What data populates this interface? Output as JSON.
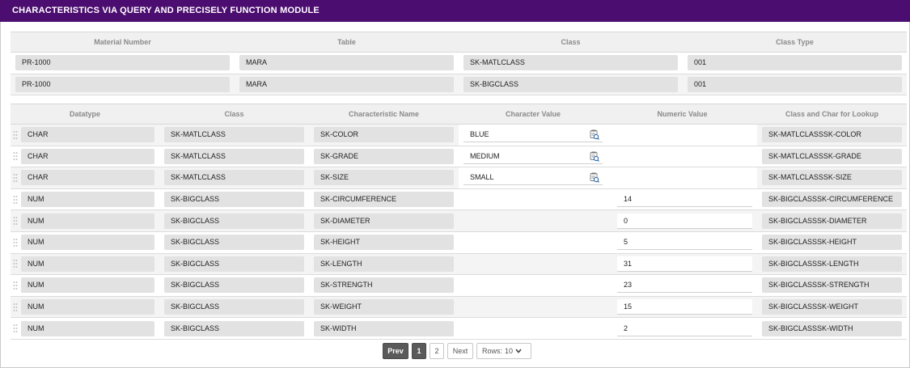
{
  "title": "CHARACTERISTICS VIA QUERY AND PRECISELY FUNCTION MODULE",
  "top_table": {
    "headers": [
      "Material Number",
      "Table",
      "Class",
      "Class Type"
    ],
    "rows": [
      {
        "material": "PR-1000",
        "table": "MARA",
        "class": "SK-MATLCLASS",
        "class_type": "001"
      },
      {
        "material": "PR-1000",
        "table": "MARA",
        "class": "SK-BIGCLASS",
        "class_type": "001"
      }
    ]
  },
  "char_table": {
    "headers": [
      "Datatype",
      "Class",
      "Characteristic Name",
      "Character Value",
      "Numeric Value",
      "Class and Char for Lookup"
    ],
    "rows": [
      {
        "datatype": "CHAR",
        "class": "SK-MATLCLASS",
        "char_name": "SK-COLOR",
        "char_value": "BLUE",
        "num_value": "",
        "lookup": "SK-MATLCLASSSK-COLOR"
      },
      {
        "datatype": "CHAR",
        "class": "SK-MATLCLASS",
        "char_name": "SK-GRADE",
        "char_value": "MEDIUM",
        "num_value": "",
        "lookup": "SK-MATLCLASSSK-GRADE"
      },
      {
        "datatype": "CHAR",
        "class": "SK-MATLCLASS",
        "char_name": "SK-SIZE",
        "char_value": "SMALL",
        "num_value": "",
        "lookup": "SK-MATLCLASSSK-SIZE"
      },
      {
        "datatype": "NUM",
        "class": "SK-BIGCLASS",
        "char_name": "SK-CIRCUMFERENCE",
        "char_value": "",
        "num_value": "14",
        "lookup": "SK-BIGCLASSSK-CIRCUMFERENCE"
      },
      {
        "datatype": "NUM",
        "class": "SK-BIGCLASS",
        "char_name": "SK-DIAMETER",
        "char_value": "",
        "num_value": "0",
        "lookup": "SK-BIGCLASSSK-DIAMETER"
      },
      {
        "datatype": "NUM",
        "class": "SK-BIGCLASS",
        "char_name": "SK-HEIGHT",
        "char_value": "",
        "num_value": "5",
        "lookup": "SK-BIGCLASSSK-HEIGHT"
      },
      {
        "datatype": "NUM",
        "class": "SK-BIGCLASS",
        "char_name": "SK-LENGTH",
        "char_value": "",
        "num_value": "31",
        "lookup": "SK-BIGCLASSSK-LENGTH"
      },
      {
        "datatype": "NUM",
        "class": "SK-BIGCLASS",
        "char_name": "SK-STRENGTH",
        "char_value": "",
        "num_value": "23",
        "lookup": "SK-BIGCLASSSK-STRENGTH"
      },
      {
        "datatype": "NUM",
        "class": "SK-BIGCLASS",
        "char_name": "SK-WEIGHT",
        "char_value": "",
        "num_value": "15",
        "lookup": "SK-BIGCLASSSK-WEIGHT"
      },
      {
        "datatype": "NUM",
        "class": "SK-BIGCLASS",
        "char_name": "SK-WIDTH",
        "char_value": "",
        "num_value": "2",
        "lookup": "SK-BIGCLASSSK-WIDTH"
      }
    ]
  },
  "pager": {
    "prev_label": "Prev",
    "pages": [
      "1",
      "2"
    ],
    "active_page": "1",
    "next_label": "Next",
    "rows_label": "Rows:",
    "rows_value": "10"
  },
  "icons": {
    "lookup": "value-help-icon",
    "drag": "drag-handle-icon",
    "rows_dropdown": "chevron-down-icon"
  },
  "colors": {
    "title_bar": "#4b0d6f",
    "lookup_icon_blue": "#2a6fb5"
  }
}
